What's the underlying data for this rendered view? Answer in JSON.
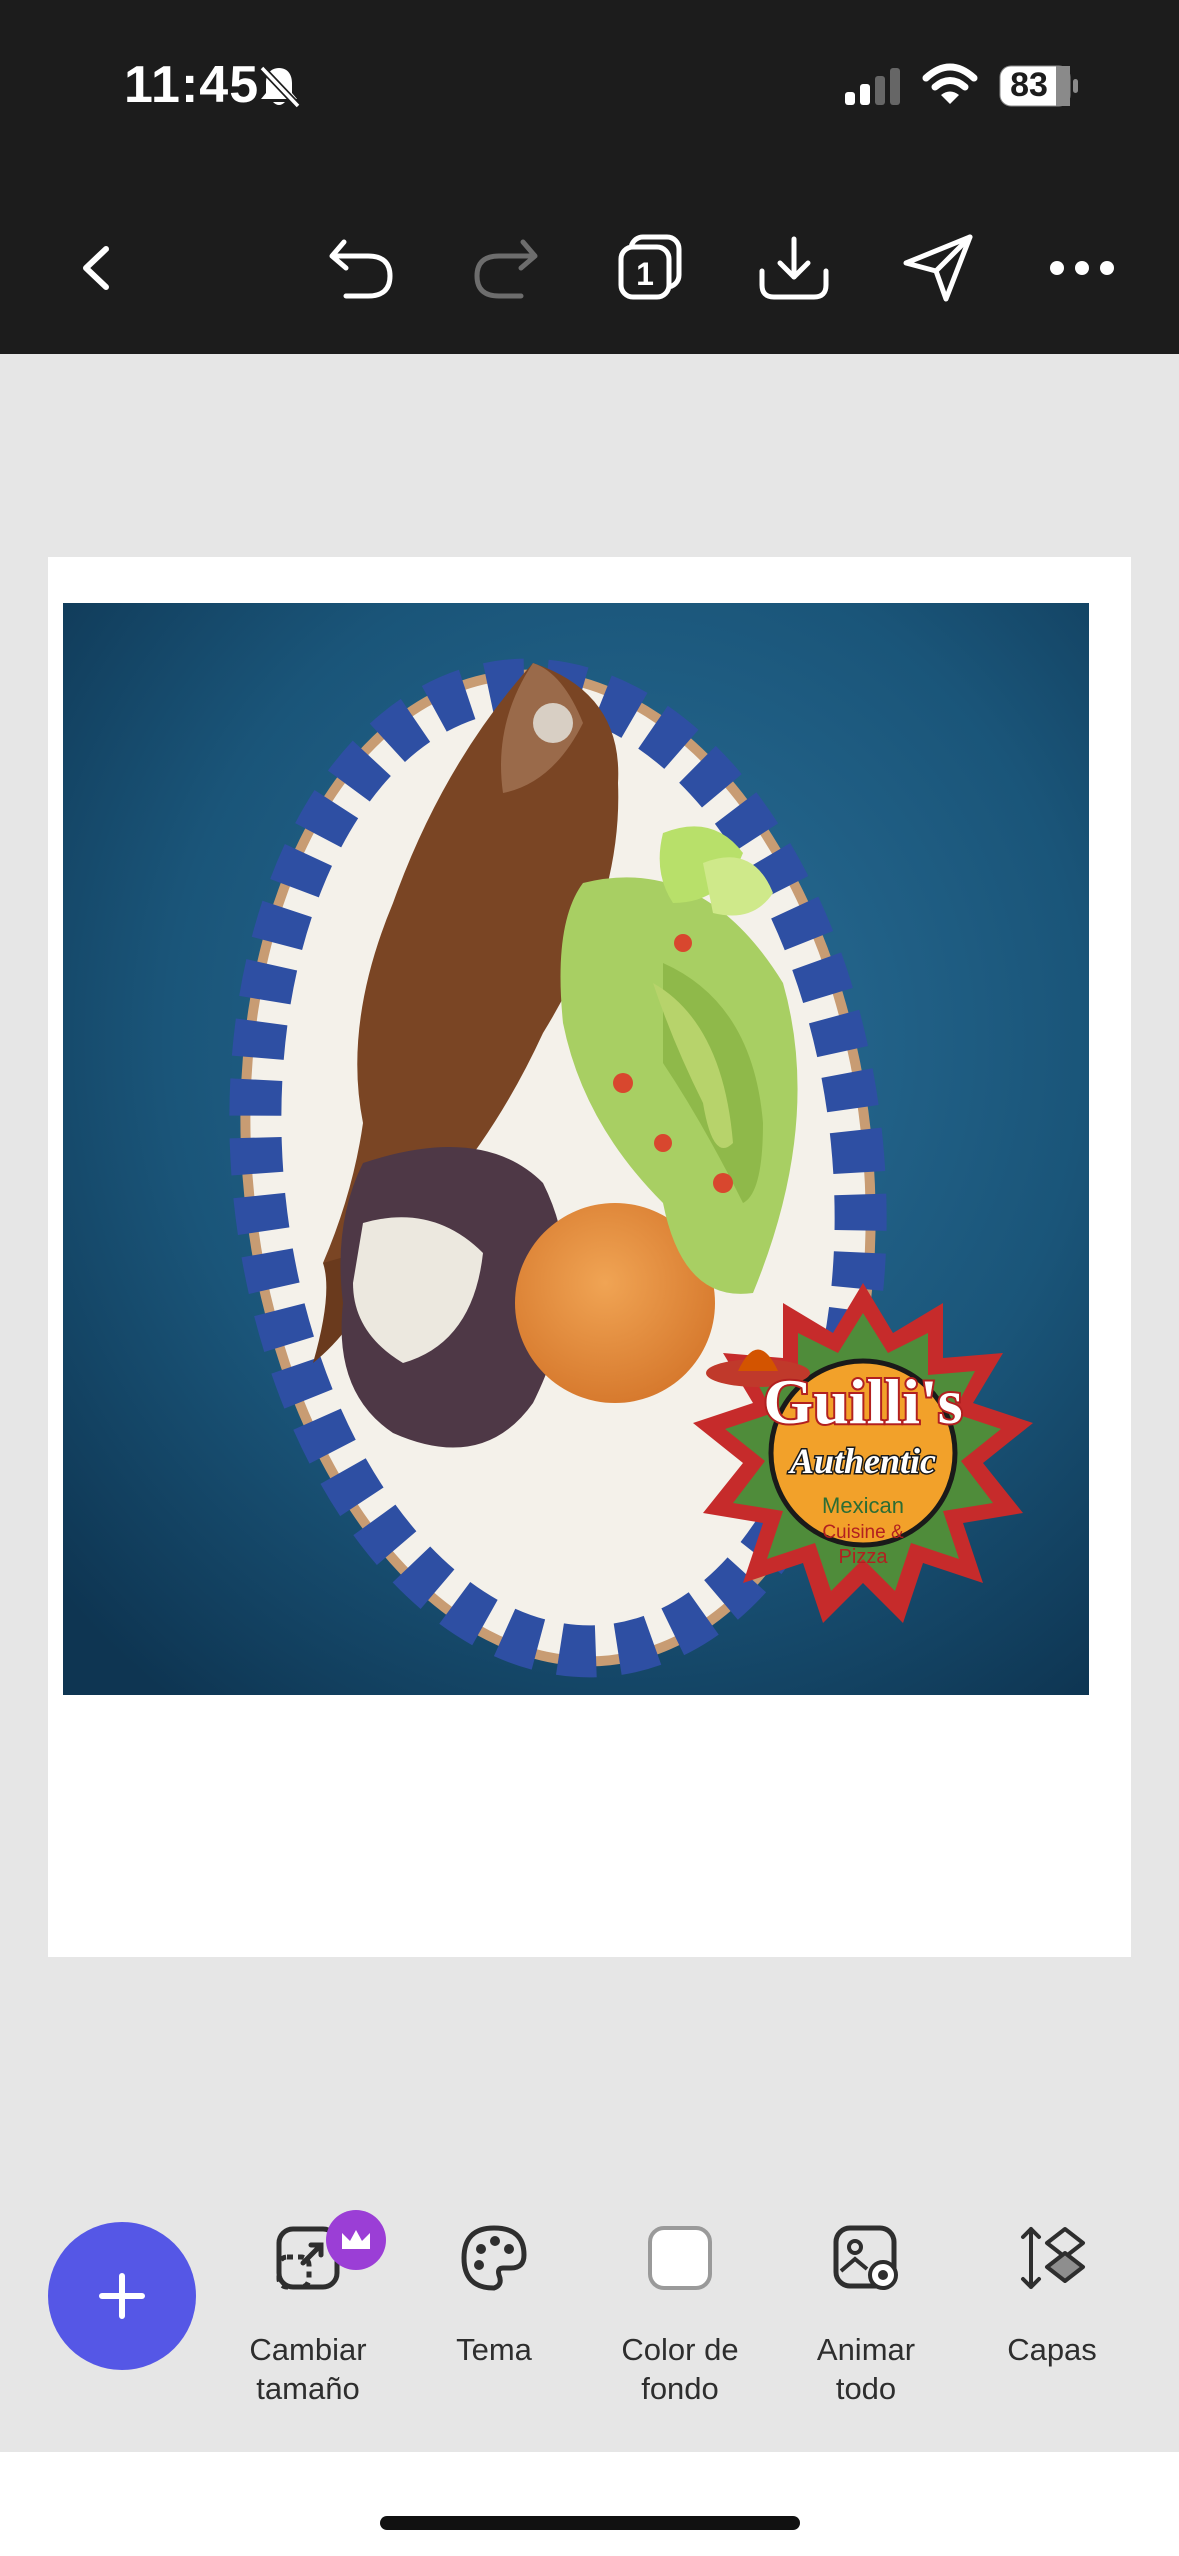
{
  "status_bar": {
    "time": "11:45",
    "battery": "83",
    "icons": [
      "bell-slash-icon",
      "cellular-signal-icon",
      "wifi-icon",
      "battery-icon"
    ]
  },
  "toolbar": {
    "icons": [
      "back-chevron-icon",
      "undo-icon",
      "redo-icon",
      "pages-icon",
      "download-icon",
      "share-send-icon",
      "more-icon"
    ],
    "pages_count": "1"
  },
  "canvas": {
    "background": "#ffffff",
    "logo": {
      "name": "Guilli's",
      "line2": "Authentic",
      "line3": "Mexican",
      "line4": "Cuisine &",
      "line5": "Pizza"
    }
  },
  "bottom_tools": {
    "add_icon": "plus-icon",
    "items": [
      {
        "line1": "Cambiar",
        "line2": "tamaño",
        "icon": "resize-icon",
        "premium": true
      },
      {
        "line1": "Tema",
        "line2": "",
        "icon": "palette-icon"
      },
      {
        "line1": "Color de",
        "line2": "fondo",
        "icon": "color-swatch-icon"
      },
      {
        "line1": "Animar",
        "line2": "todo",
        "icon": "animate-icon"
      },
      {
        "line1": "Capas",
        "line2": "",
        "icon": "layers-icon"
      }
    ]
  },
  "colors": {
    "topbar": "#1c1c1c",
    "workspace": "#e6e6e6",
    "accent": "#5557e6",
    "premium": "#9b3ed6",
    "photo_background": "#1d5a80"
  }
}
